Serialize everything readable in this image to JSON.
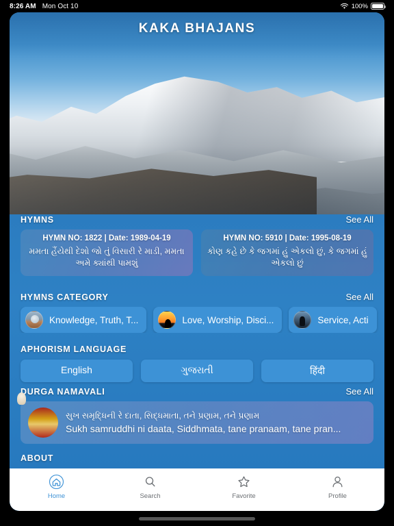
{
  "statusbar": {
    "time": "8:26 AM",
    "date": "Mon Oct 10",
    "battery_percent": "100%",
    "wifi_icon": "wifi-icon",
    "battery_icon": "battery-icon"
  },
  "app": {
    "title": "KAKA BHAJANS",
    "accent_color": "#3d92d6",
    "header_color": "#2b7cc0"
  },
  "sections": {
    "hymns": {
      "title": "HYMNS",
      "see_all": "See All",
      "cards": [
        {
          "meta": "HYMN NO: 1822 | Date: 1989-04-19",
          "text": "મમતા હૈંયેથી દેશો જો તું વિસારી રે માડી, મમતા અમે ક્યાંથી પામશું"
        },
        {
          "meta": "HYMN NO: 5910 | Date: 1995-08-19",
          "text": "કોણ કહે છે કે જગમાં હું એકલો છું, કે જગમાં હું એકલો છું"
        }
      ]
    },
    "hymns_category": {
      "title": "HYMNS CATEGORY",
      "see_all": "See All",
      "chips": [
        {
          "label": "Knowledge, Truth, T...",
          "icon": "knowledge-thumbnail"
        },
        {
          "label": "Love, Worship, Disci...",
          "icon": "love-worship-thumbnail"
        },
        {
          "label": "Service, Acti",
          "icon": "service-thumbnail"
        }
      ]
    },
    "aphorism_language": {
      "title": "APHORISM LANGUAGE",
      "options": [
        {
          "label": "English"
        },
        {
          "label": "ગુજરાતી"
        },
        {
          "label": "हिंदी"
        }
      ]
    },
    "durga_namavali": {
      "title": "DURGA NAMAVALI",
      "see_all": "See All",
      "item": {
        "icon": "durga-thumbnail",
        "line1": "સુખ સમૃદ્ધિની રે દાતા, સિદ્ધમાતા, તને પ્રણામ, તને પ્રણામ",
        "line2": "Sukh samruddhi ni daata, Siddhmata, tane pranaam, tane pran..."
      }
    },
    "about": {
      "title": "ABOUT",
      "cards": [
        {
          "icon": "about-thumbnail-1"
        },
        {
          "icon": "about-thumbnail-2"
        },
        {
          "icon": "about-thumbnail-3"
        },
        {
          "icon": "about-thumbnail-4"
        },
        {
          "icon": "about-thumbnail-5"
        }
      ]
    }
  },
  "tabbar": {
    "items": [
      {
        "label": "Home",
        "icon": "home-icon",
        "active": true
      },
      {
        "label": "Search",
        "icon": "search-icon",
        "active": false
      },
      {
        "label": "Favorite",
        "icon": "star-icon",
        "active": false
      },
      {
        "label": "Profile",
        "icon": "person-icon",
        "active": false
      }
    ]
  }
}
